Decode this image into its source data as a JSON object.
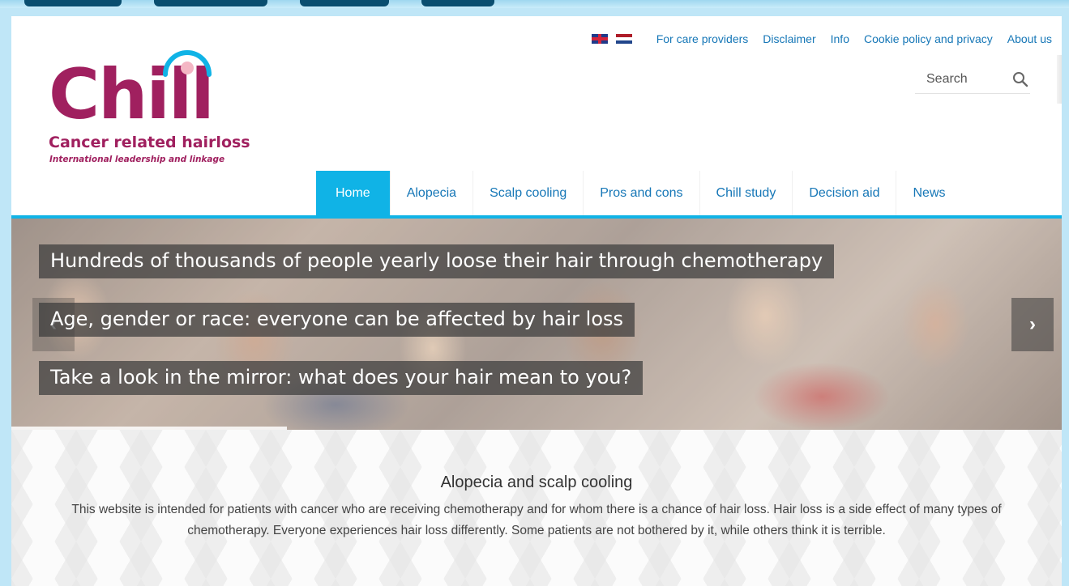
{
  "site": {
    "logo": {
      "name": "Chill",
      "subtitle": "Cancer related hairloss",
      "tagline": "International leadership and linkage",
      "brand_color": "#a0205f",
      "accent_color": "#10b3e6"
    },
    "flags": [
      "flag-uk-icon",
      "flag-nl-icon"
    ]
  },
  "top_links": [
    {
      "label": "For care providers"
    },
    {
      "label": "Disclaimer"
    },
    {
      "label": "Info"
    },
    {
      "label": "Cookie policy and privacy"
    },
    {
      "label": "About us"
    }
  ],
  "search": {
    "placeholder": "Search",
    "icon": "search-icon"
  },
  "nav": {
    "items": [
      {
        "label": "Home",
        "active": true
      },
      {
        "label": "Alopecia"
      },
      {
        "label": "Scalp cooling"
      },
      {
        "label": "Pros and cons"
      },
      {
        "label": "Chill study"
      },
      {
        "label": "Decision aid"
      },
      {
        "label": "News"
      }
    ]
  },
  "slider": {
    "captions": [
      "Hundreds of thousands of people yearly loose their hair through chemotherapy",
      "Age, gender or race: everyone can be affected by hair loss",
      "Take a look in the mirror: what does your hair mean to you?"
    ],
    "prev_icon": "chevron-left-icon",
    "next_icon": "chevron-right-icon",
    "prev_glyph": "‹",
    "next_glyph": "›"
  },
  "content": {
    "title": "Alopecia and scalp cooling",
    "text": "This website is intended for patients with cancer who are receiving chemotherapy and for whom there is a chance of hair loss. Hair loss is a side effect of many types of chemotherapy. Everyone experiences hair loss differently. Some patients are not bothered by it, while others think it is terrible."
  }
}
